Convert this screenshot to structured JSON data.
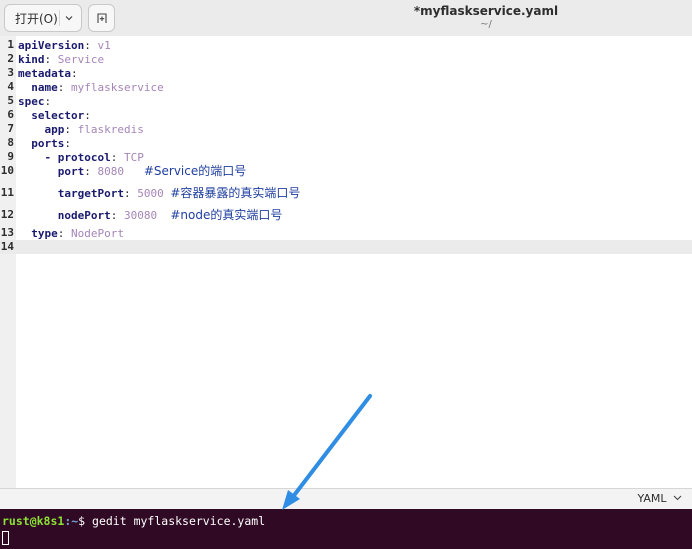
{
  "header": {
    "open_label": "打开(O)",
    "title": "*myflaskservice.yaml",
    "subtitle": "~/"
  },
  "editor": {
    "lines": [
      {
        "n": "1",
        "key": "apiVersion",
        "sep": ": ",
        "val": "v1",
        "comment": ""
      },
      {
        "n": "2",
        "key": "kind",
        "sep": ": ",
        "val": "Service",
        "comment": ""
      },
      {
        "n": "3",
        "key": "metadata",
        "sep": ":",
        "val": "",
        "comment": ""
      },
      {
        "n": "4",
        "key": "  name",
        "sep": ": ",
        "val": "myflaskservice",
        "comment": ""
      },
      {
        "n": "5",
        "key": "spec",
        "sep": ":",
        "val": "",
        "comment": ""
      },
      {
        "n": "6",
        "key": "  selector",
        "sep": ":",
        "val": "",
        "comment": ""
      },
      {
        "n": "7",
        "key": "    app",
        "sep": ": ",
        "val": "flaskredis",
        "comment": ""
      },
      {
        "n": "8",
        "key": "  ports",
        "sep": ":",
        "val": "",
        "comment": ""
      },
      {
        "n": "9",
        "key": "    - protocol",
        "sep": ": ",
        "val": "TCP",
        "comment": ""
      },
      {
        "n": "10",
        "key": "      port",
        "sep": ": ",
        "val": "8080   ",
        "comment": "#Service的端口号"
      },
      {
        "n": "11",
        "key": "      targetPort",
        "sep": ": ",
        "val": "5000 ",
        "comment": "#容器暴露的真实端口号"
      },
      {
        "n": "12",
        "key": "      nodePort",
        "sep": ": ",
        "val": "30080  ",
        "comment": "#node的真实端口号"
      },
      {
        "n": "13",
        "key": "  type",
        "sep": ": ",
        "val": "NodePort",
        "comment": ""
      },
      {
        "n": "14",
        "key": "",
        "sep": "",
        "val": "",
        "comment": ""
      }
    ]
  },
  "statusbar": {
    "language": "YAML"
  },
  "terminal": {
    "user_host": "rust@k8s1",
    "path": ":~",
    "prompt_symbol": "$ ",
    "command": "gedit myflaskservice.yaml"
  },
  "colors": {
    "terminal_bg": "#300a24",
    "arrow": "#2f8de4",
    "comment": "#1f3fa0"
  }
}
